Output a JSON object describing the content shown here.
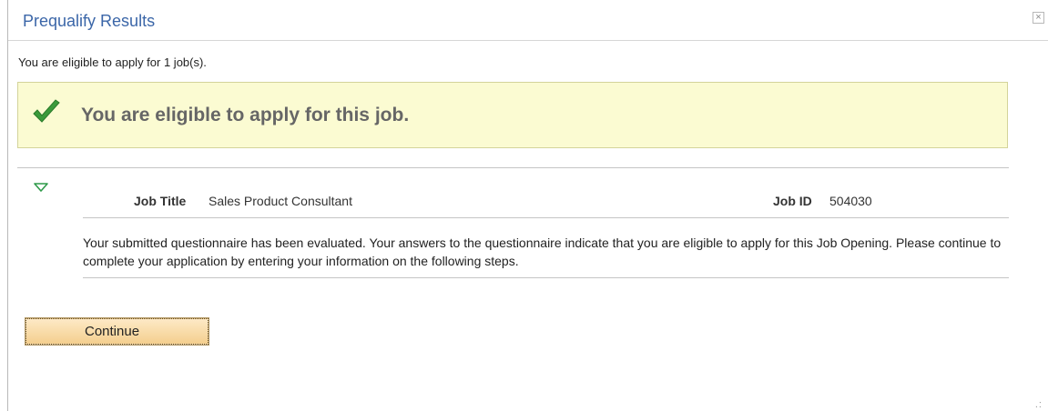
{
  "dialog": {
    "title": "Prequalify Results",
    "close_label": "×"
  },
  "summary_text": "You are eligible to apply for 1 job(s).",
  "eligibility": {
    "message": "You are eligible to apply for this job.",
    "icon": "checkmark-icon",
    "color": "#3b9a3b"
  },
  "job": {
    "title_label": "Job Title",
    "title_value": "Sales Product Consultant",
    "id_label": "Job ID",
    "id_value": "504030",
    "description": "Your submitted questionnaire has been evaluated. Your answers to the questionnaire indicate that you are eligible to apply for this Job Opening. Please continue to complete your application by entering your information on the following steps."
  },
  "actions": {
    "continue_label": "Continue"
  },
  "colors": {
    "title": "#3b66a8",
    "eligible_bg": "#fbfbd2",
    "button_bg": "#f4cf8e"
  }
}
